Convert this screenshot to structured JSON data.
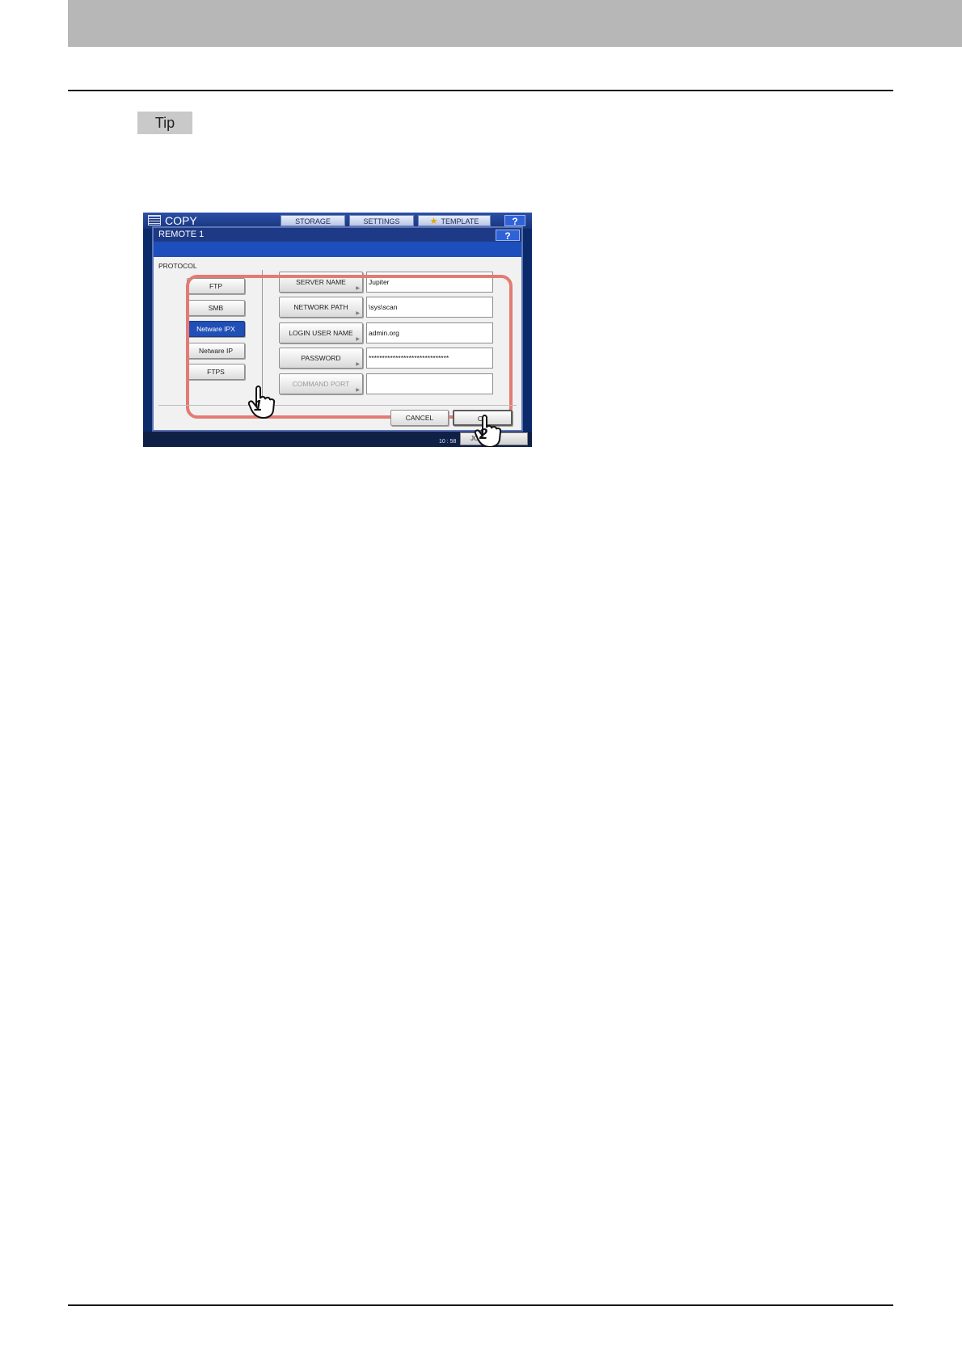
{
  "tip": {
    "label": "Tip"
  },
  "screen": {
    "app_title": "COPY",
    "tabs": [
      {
        "label": "STORAGE"
      },
      {
        "label": "SETTINGS"
      },
      {
        "label": "TEMPLATE",
        "icon": "star-icon"
      }
    ],
    "help_label": "?",
    "dialog": {
      "title": "REMOTE 1",
      "help_label": "?",
      "protocol_label": "PROTOCOL",
      "protocols": [
        {
          "label": "FTP",
          "selected": false
        },
        {
          "label": "SMB",
          "selected": false
        },
        {
          "label": "Netware IPX",
          "selected": true
        },
        {
          "label": "Netware IP",
          "selected": false
        },
        {
          "label": "FTPS",
          "selected": false
        }
      ],
      "fields": [
        {
          "label": "SERVER NAME",
          "value": "Jupiter",
          "enabled": true
        },
        {
          "label": "NETWORK PATH",
          "value": "\\sys\\scan",
          "enabled": true
        },
        {
          "label": "LOGIN USER NAME",
          "value": "admin.org",
          "enabled": true
        },
        {
          "label": "PASSWORD",
          "value": "******************************",
          "enabled": true
        },
        {
          "label": "COMMAND PORT",
          "value": "",
          "enabled": false
        }
      ],
      "cancel_label": "CANCEL",
      "ok_label": "OK"
    },
    "status": {
      "time": "10 : 58",
      "job_label": "JOB S"
    },
    "step_markers": [
      "1",
      "2"
    ],
    "highlight_color": "#e37b73"
  }
}
